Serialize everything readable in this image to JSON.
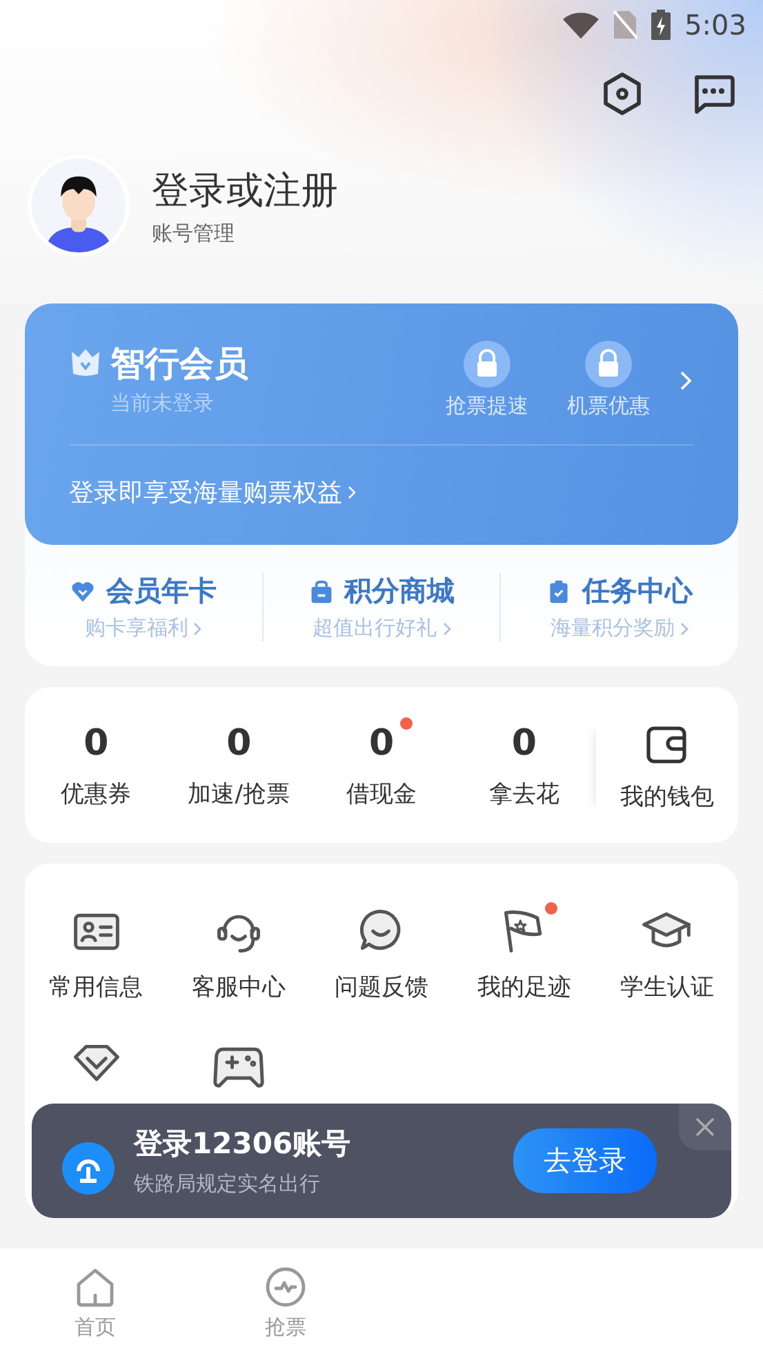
{
  "status_bar": {
    "time": "5:03"
  },
  "profile": {
    "title": "登录或注册",
    "subtitle": "账号管理"
  },
  "member_card": {
    "title": "智行会员",
    "status": "当前未登录",
    "perks": [
      {
        "label": "抢票提速",
        "locked": true
      },
      {
        "label": "机票优惠",
        "locked": true
      }
    ],
    "promo": "登录即享受海量购票权益"
  },
  "member_links": [
    {
      "kind": "heart",
      "title": "会员年卡",
      "subtitle": "购卡享福利"
    },
    {
      "kind": "bag",
      "title": "积分商城",
      "subtitle": "超值出行好礼"
    },
    {
      "kind": "clipboard",
      "title": "任务中心",
      "subtitle": "海量积分奖励"
    }
  ],
  "stats": [
    {
      "value": "0",
      "label": "优惠券",
      "dot": false
    },
    {
      "value": "0",
      "label": "加速/抢票",
      "dot": false
    },
    {
      "value": "0",
      "label": "借现金",
      "dot": true
    },
    {
      "value": "0",
      "label": "拿去花",
      "dot": false
    }
  ],
  "wallet": {
    "label": "我的钱包"
  },
  "services": [
    {
      "kind": "card",
      "label": "常用信息",
      "dot": false
    },
    {
      "kind": "headset",
      "label": "客服中心",
      "dot": false
    },
    {
      "kind": "chat",
      "label": "问题反馈",
      "dot": false
    },
    {
      "kind": "flag",
      "label": "我的足迹",
      "dot": true
    },
    {
      "kind": "cap",
      "label": "学生认证",
      "dot": false
    },
    {
      "kind": "gem",
      "dot": false
    },
    {
      "kind": "gamepad",
      "dot": false
    }
  ],
  "login_banner": {
    "title": "登录12306账号",
    "subtitle": "铁路局规定实名出行",
    "button": "去登录"
  },
  "tab_bar": [
    {
      "kind": "home",
      "label": "首页",
      "selected": false
    },
    {
      "kind": "pulse",
      "label": "抢票",
      "selected": false
    }
  ]
}
